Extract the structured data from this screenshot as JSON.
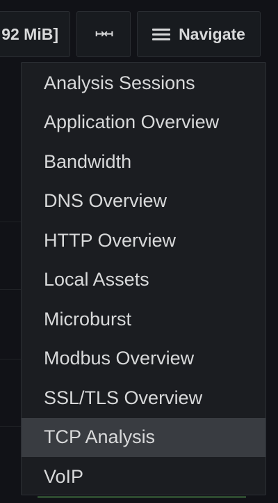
{
  "toolbar": {
    "storage_label": "92 MiB]",
    "collapse_icon": "collapse-arrows-icon",
    "collapse_glyph": "↦↤",
    "navigate_label": "Navigate"
  },
  "menu": {
    "items": [
      {
        "label": "Analysis Sessions",
        "active": false
      },
      {
        "label": "Application Overview",
        "active": false
      },
      {
        "label": "Bandwidth",
        "active": false
      },
      {
        "label": "DNS Overview",
        "active": false
      },
      {
        "label": "HTTP Overview",
        "active": false
      },
      {
        "label": "Local Assets",
        "active": false
      },
      {
        "label": "Microburst",
        "active": false
      },
      {
        "label": "Modbus Overview",
        "active": false
      },
      {
        "label": "SSL/TLS Overview",
        "active": false
      },
      {
        "label": "TCP Analysis",
        "active": true
      },
      {
        "label": "VoIP",
        "active": false
      }
    ]
  },
  "colors": {
    "background": "#111217",
    "menu_background": "#1b1d21",
    "active_item": "#393c41",
    "text": "#d8d9da"
  }
}
